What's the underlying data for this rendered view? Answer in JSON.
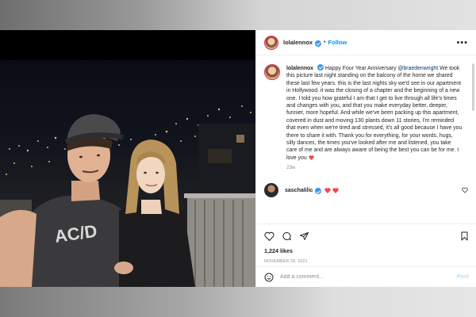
{
  "post": {
    "username": "lolalennox",
    "follow_label": "Follow",
    "more_label": "•••",
    "caption": {
      "username": "lolalennox",
      "lead": "Happy Four Year Anniversary",
      "mention": "@braedenwright",
      "body": "We took this picture last night standing on the balcony of the home we shared these last few years. this is the last nights sky we'd see in our apartment in Hollywood. it was the closing of a chapter and the beginning of a new one. I told you how grateful I am that I get to live through all life's times and changes with you, and that you make everyday better, deeper, funnier, more hopeful. And while we've been packing up this apartment, covered in dust and moving 130 plants down 11 stories, I'm reminded that even when we're tired and stressed, it's all good because I have you there to share it with. Thank you for everything, for your words, hugs, silly dances, the times you've looked after me and listened, you take care of me and are always aware of being the best you can be for me. I love you",
      "time": "23w"
    },
    "comment": {
      "username": "saschalilic"
    },
    "likes": "1,224 likes",
    "date": "NOVEMBER 28, 2021",
    "add_comment_placeholder": "Add a comment...",
    "post_label": "Post"
  },
  "colors": {
    "accent": "#0095f6",
    "verified": "#3897f0",
    "heart": "#ed4956",
    "text": "#262626",
    "muted": "#8e8e8e"
  },
  "icons": [
    "verified-badge-icon",
    "heart-icon",
    "comment-icon",
    "share-icon",
    "bookmark-icon",
    "emoji-icon"
  ]
}
